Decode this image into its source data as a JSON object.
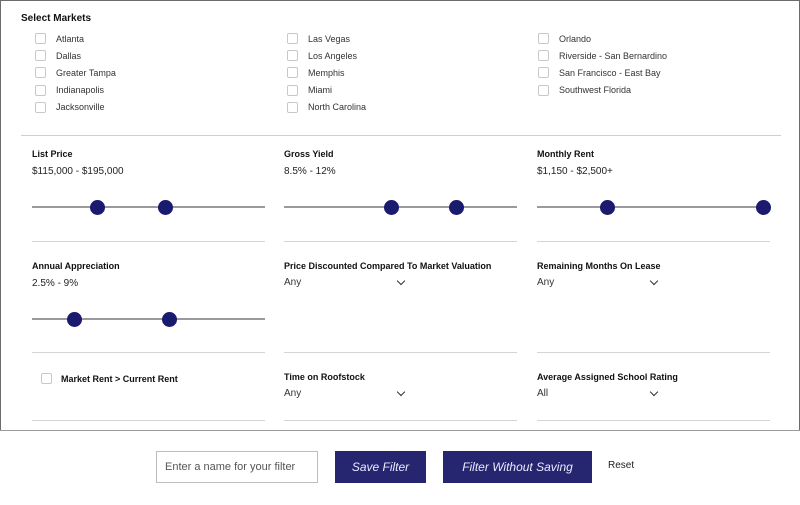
{
  "markets": {
    "title": "Select Markets",
    "columns": [
      [
        "Atlanta",
        "Dallas",
        "Greater Tampa",
        "Indianapolis",
        "Jacksonville"
      ],
      [
        "Las Vegas",
        "Los Angeles",
        "Memphis",
        "Miami",
        "North Carolina"
      ],
      [
        "Orlando",
        "Riverside - San Bernardino",
        "San Francisco - East Bay",
        "Southwest Florida"
      ]
    ]
  },
  "filters": {
    "list_price": {
      "label": "List Price",
      "value": "$115,000 - $195,000",
      "low": 0.28,
      "high": 0.57
    },
    "gross_yield": {
      "label": "Gross Yield",
      "value": "8.5% - 12%",
      "low": 0.46,
      "high": 0.74
    },
    "monthly_rent": {
      "label": "Monthly Rent",
      "value": "$1,150 - $2,500+",
      "low": 0.3,
      "high": 0.97
    },
    "annual_appreciation": {
      "label": "Annual Appreciation",
      "value": "2.5% - 9%",
      "low": 0.18,
      "high": 0.59
    },
    "price_discounted": {
      "label": "Price Discounted Compared To Market Valuation",
      "selected": "Any"
    },
    "remaining_months": {
      "label": "Remaining Months On Lease",
      "selected": "Any"
    },
    "market_rent": {
      "label": "Market Rent > Current Rent"
    },
    "time_on_roofstock": {
      "label": "Time on Roofstock",
      "selected": "Any"
    },
    "school_rating": {
      "label": "Average Assigned School Rating",
      "selected": "All"
    }
  },
  "actions": {
    "name_placeholder": "Enter a name for your filter",
    "save_label": "Save Filter",
    "filter_without_saving_label": "Filter Without Saving",
    "reset_label": "Reset"
  },
  "colors": {
    "accent": "#262670",
    "thumb": "#1a1a6e"
  },
  "icons": {
    "dropdown": "chevron-down-icon",
    "checkbox": "checkbox-icon"
  }
}
